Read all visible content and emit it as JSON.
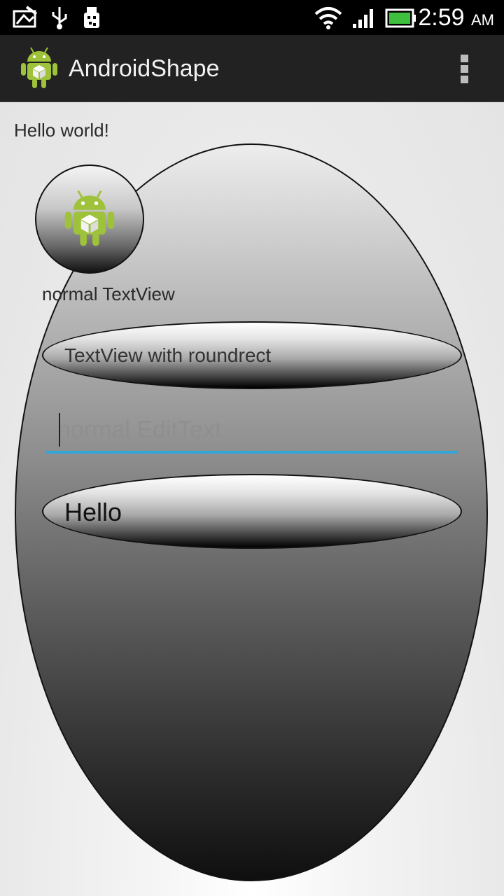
{
  "status_bar": {
    "time": "2:59",
    "ampm": "AM",
    "icons": [
      "photo-icon",
      "usb-icon",
      "debug-icon",
      "wifi-icon",
      "signal-icon",
      "battery-icon"
    ]
  },
  "action_bar": {
    "app_title": "AndroidShape",
    "app_icon": "android-robot-icon",
    "overflow_icon": "overflow-menu-icon"
  },
  "content": {
    "hello_world": "Hello world!",
    "normal_textview": "normal TextView",
    "roundrect_textview": "TextView with roundrect",
    "edit_text": {
      "value": "",
      "placeholder": "normal EditText"
    },
    "button_label": "Hello"
  },
  "colors": {
    "status_bar_bg": "#000000",
    "action_bar_bg": "#222222",
    "edit_underline": "#33a6d8",
    "android_green": "#9ec23a"
  }
}
